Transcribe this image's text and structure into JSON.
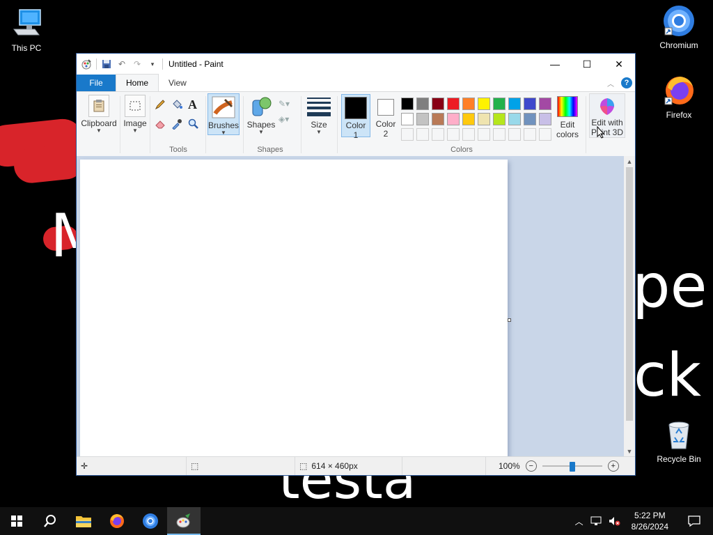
{
  "desktop": {
    "background_text": [
      "M",
      "pe",
      "ck",
      "testa"
    ],
    "icons": [
      {
        "name": "this-pc",
        "label": "This PC"
      },
      {
        "name": "chromium",
        "label": "Chromium"
      },
      {
        "name": "firefox",
        "label": "Firefox"
      },
      {
        "name": "recycle-bin",
        "label": "Recycle Bin"
      }
    ]
  },
  "window": {
    "title": "Untitled - Paint",
    "tabs": {
      "file": "File",
      "home": "Home",
      "view": "View"
    },
    "help": "?"
  },
  "ribbon": {
    "clipboard": "Clipboard",
    "image": "Image",
    "tools_group": "Tools",
    "brushes": "Brushes",
    "shapes": "Shapes",
    "shapes_group": "Shapes",
    "size": "Size",
    "color1": "Color",
    "color1_num": "1",
    "color2": "Color",
    "color2_num": "2",
    "colors_group": "Colors",
    "edit_colors_1": "Edit",
    "edit_colors_2": "colors",
    "paint3d_1": "Edit with",
    "paint3d_2": "Paint 3D"
  },
  "palette": {
    "row1": [
      "#000000",
      "#7f7f7f",
      "#880015",
      "#ed1c24",
      "#ff7f27",
      "#fff200",
      "#22b14c",
      "#00a2e8",
      "#3f48cc",
      "#a349a4"
    ],
    "row2": [
      "#ffffff",
      "#c3c3c3",
      "#b97a57",
      "#ffaec9",
      "#ffc90e",
      "#efe4b0",
      "#b5e61d",
      "#99d9ea",
      "#7092be",
      "#c8bfe7"
    ]
  },
  "status": {
    "canvas_size": "614 × 460px",
    "zoom": "100%"
  },
  "taskbar": {
    "time": "5:22 PM",
    "date": "8/26/2024"
  }
}
